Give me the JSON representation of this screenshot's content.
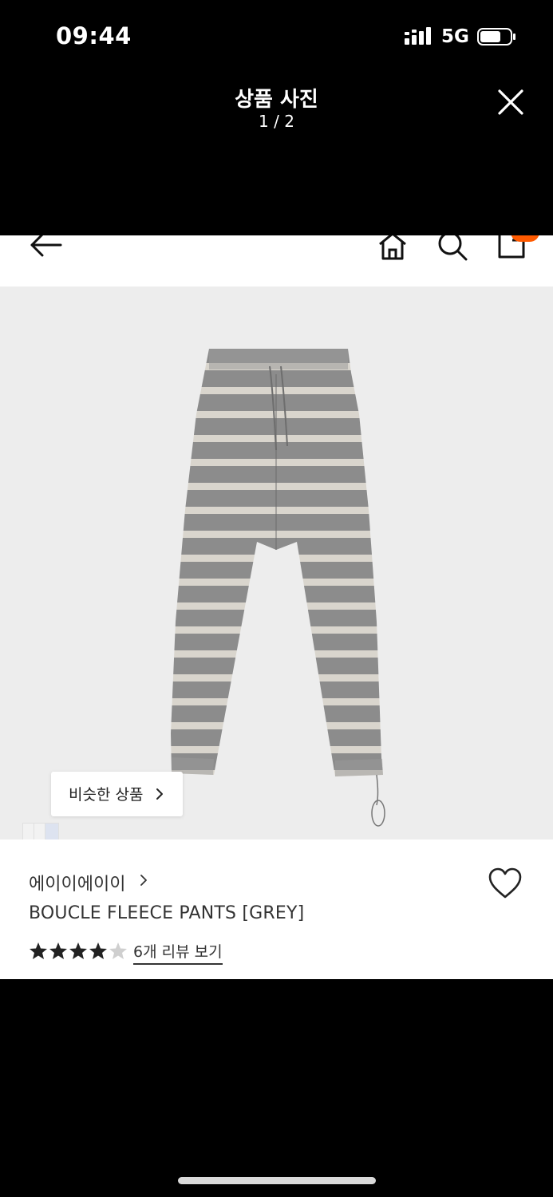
{
  "status_bar": {
    "time": "09:44",
    "network": "5G"
  },
  "viewer": {
    "title": "상품 사진",
    "counter": "1 / 2"
  },
  "nav_icons": [
    "back-arrow-icon",
    "home-icon",
    "search-icon",
    "cart-icon"
  ],
  "product": {
    "similar_button_label": "비슷한 상품",
    "brand": "에이이에이이",
    "name": "BOUCLE FLEECE PANTS [GREY]",
    "rating_stars": 4.5,
    "review_link": "6개 리뷰 보기"
  },
  "colors": {
    "accent_badge": "#ff5a00",
    "image_bg": "#ededed",
    "pants_grey": "#8a8a8a",
    "stripe_light": "#d6d3cc"
  }
}
